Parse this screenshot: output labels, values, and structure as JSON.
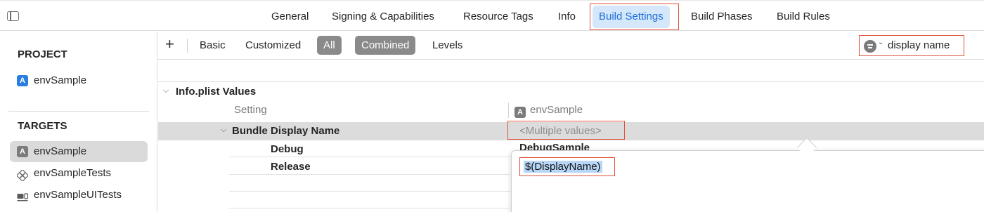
{
  "tabs": [
    "General",
    "Signing & Capabilities",
    "Resource Tags",
    "Info",
    "Build Settings",
    "Build Phases",
    "Build Rules"
  ],
  "sidebar": {
    "project_header": "PROJECT",
    "project_items": [
      "envSample"
    ],
    "targets_header": "TARGETS",
    "target_items": [
      "envSample",
      "envSampleTests",
      "envSampleUITests"
    ]
  },
  "filterbar": {
    "add": "+",
    "basic": "Basic",
    "customized": "Customized",
    "all": "All",
    "combined": "Combined",
    "levels": "Levels",
    "search_value": "display name"
  },
  "settings": {
    "group_title": "Info.plist Values",
    "col_setting": "Setting",
    "col_target": "envSample",
    "bundle_name": "Bundle Display Name",
    "bundle_value": "<Multiple values>",
    "debug_label": "Debug",
    "debug_value": "DebugSample",
    "release_label": "Release",
    "editor_value": "$(DisplayName)"
  },
  "colors": {
    "highlight": "#e0533a",
    "selected_tab": "#1d6fd9"
  }
}
